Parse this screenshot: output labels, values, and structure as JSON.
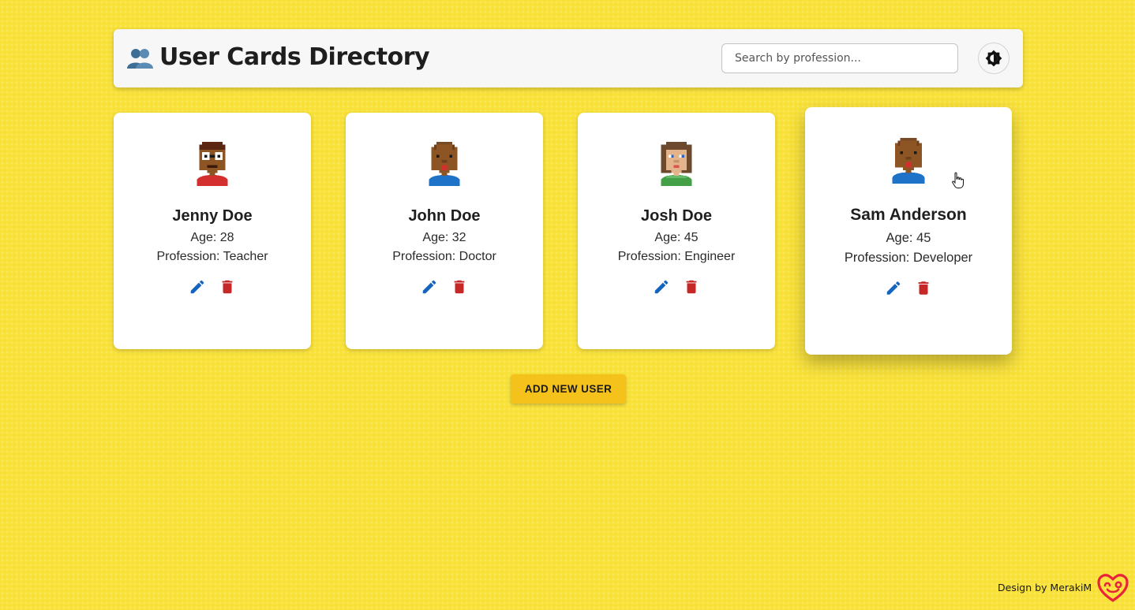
{
  "header": {
    "title": "User Cards Directory",
    "title_icon": "busts-in-silhouette-icon",
    "search_placeholder": "Search by profession...",
    "theme_toggle_icon": "brightness-icon"
  },
  "users": [
    {
      "name": "Jenny Doe",
      "age": "Age: 28",
      "profession": "Profession: Teacher",
      "avatar": "pixel-avatar-glasses"
    },
    {
      "name": "John Doe",
      "age": "Age: 32",
      "profession": "Profession: Doctor",
      "avatar": "pixel-avatar-bald"
    },
    {
      "name": "Josh Doe",
      "age": "Age: 45",
      "profession": "Profession: Engineer",
      "avatar": "pixel-avatar-long-hair"
    },
    {
      "name": "Sam Anderson",
      "age": "Age: 45",
      "profession": "Profession: Developer",
      "avatar": "pixel-avatar-bald"
    }
  ],
  "card_actions": {
    "edit_icon": "pencil-icon",
    "delete_icon": "trash-icon",
    "edit_color": "#1565c0",
    "delete_color": "#c62828"
  },
  "add_button": {
    "label": "ADD NEW USER",
    "color": "#f5c21c"
  },
  "footer": {
    "credit": "Design by MerakiM",
    "logo_color": "#e8233a"
  },
  "colors": {
    "background": "#f9e23c",
    "header_bg": "#f7f7f7",
    "card_bg": "#ffffff"
  }
}
